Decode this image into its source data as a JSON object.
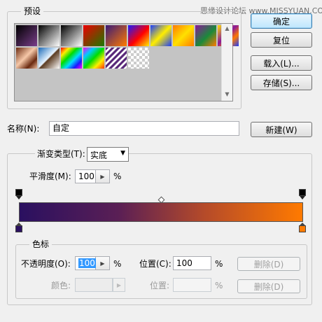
{
  "watermark": "思缘设计论坛 www.MISSYUAN.COM",
  "presets": {
    "legend": "预设",
    "swatches": [
      {
        "name": "foreground-to-background",
        "css": "linear-gradient(135deg, #000 0%, #7a3d8a 100%)"
      },
      {
        "name": "foreground-to-transparent",
        "css": "linear-gradient(135deg, #000 0%, rgba(0,0,0,0) 100%)"
      },
      {
        "name": "black-white",
        "css": "linear-gradient(135deg, #000 0%, #fff 100%)"
      },
      {
        "name": "red-green",
        "css": "linear-gradient(135deg, #e00 0%, #1a7a00 100%)"
      },
      {
        "name": "violet-orange",
        "css": "linear-gradient(135deg, #3a1a78 0%, #ff7a00 100%)"
      },
      {
        "name": "blue-red-yellow",
        "css": "linear-gradient(135deg, #1a1aff 0%, #ff0000 55%, #ffee00 100%)"
      },
      {
        "name": "blue-yellow-blue",
        "css": "linear-gradient(135deg, #1a3cff 0%, #ffee00 50%, #1a3cff 100%)"
      },
      {
        "name": "orange-yellow-orange",
        "css": "linear-gradient(135deg, #ff7a00 0%, #ffe000 50%, #ff7a00 100%)"
      },
      {
        "name": "violet-green-orange",
        "css": "linear-gradient(135deg, #8a1a9a 0%, #1a8a3a 55%, #ff7a00 100%)"
      },
      {
        "name": "yellow-violet-orange-blue",
        "css": "linear-gradient(135deg, #ffe000 0%, #8a1a9a 45%, #ff7a00 70%, #1a3cff 100%)"
      },
      {
        "name": "copper",
        "css": "linear-gradient(135deg, #6a2a10 0%, #f6c8a8 45%, #6a2a10 75%, #e8b898 100%)"
      },
      {
        "name": "chrome",
        "css": "linear-gradient(135deg, #1a6ab8 0%, #e8f4ff 48%, #5a3a20 52%, #fff 100%)"
      },
      {
        "name": "spectrum",
        "css": "linear-gradient(135deg, #ff0000 0%, #ffee00 20%, #00dd00 40%, #00ddff 60%, #1a1aff 80%, #ff00ff 100%)"
      },
      {
        "name": "transparent-rainbow",
        "css": "linear-gradient(135deg, #ff00ff 0%, #00ccff 25%, #00dd00 50%, #ffee00 75%, #ff3300 100%)"
      },
      {
        "name": "transparent-stripes",
        "css": "repeating-linear-gradient(135deg, #5a2a7a 0px, #5a2a7a 3px, #fff 3px, #fff 6px)"
      },
      {
        "name": "transparent-checker",
        "css": ""
      }
    ]
  },
  "buttons": {
    "ok": "确定",
    "reset": "复位",
    "load": "载入(L)...",
    "save": "存储(S)...",
    "new": "新建(W)"
  },
  "name_field": {
    "label": "名称(N):",
    "value": "自定"
  },
  "gradient": {
    "type_label": "渐变类型(T):",
    "type_value": "实底",
    "smoothness_label": "平滑度(M):",
    "smoothness_value": "100",
    "smoothness_unit": "%",
    "bar_css": "linear-gradient(to right, #2a1060 0%, #5a1f55 35%, #b44a2a 65%, #ff7a00 100%)",
    "start_color": "#2a1060",
    "end_color": "#ff7a00"
  },
  "stops": {
    "legend": "色标",
    "opacity_label": "不透明度(O):",
    "opacity_value": "100",
    "opacity_unit": "%",
    "opacity_location_label": "位置(C):",
    "opacity_location_value": "100",
    "opacity_location_unit": "%",
    "opacity_delete": "删除(D)",
    "color_label": "颜色:",
    "color_location_label": "位置:",
    "color_location_unit": "%",
    "color_delete": "删除(D)"
  }
}
